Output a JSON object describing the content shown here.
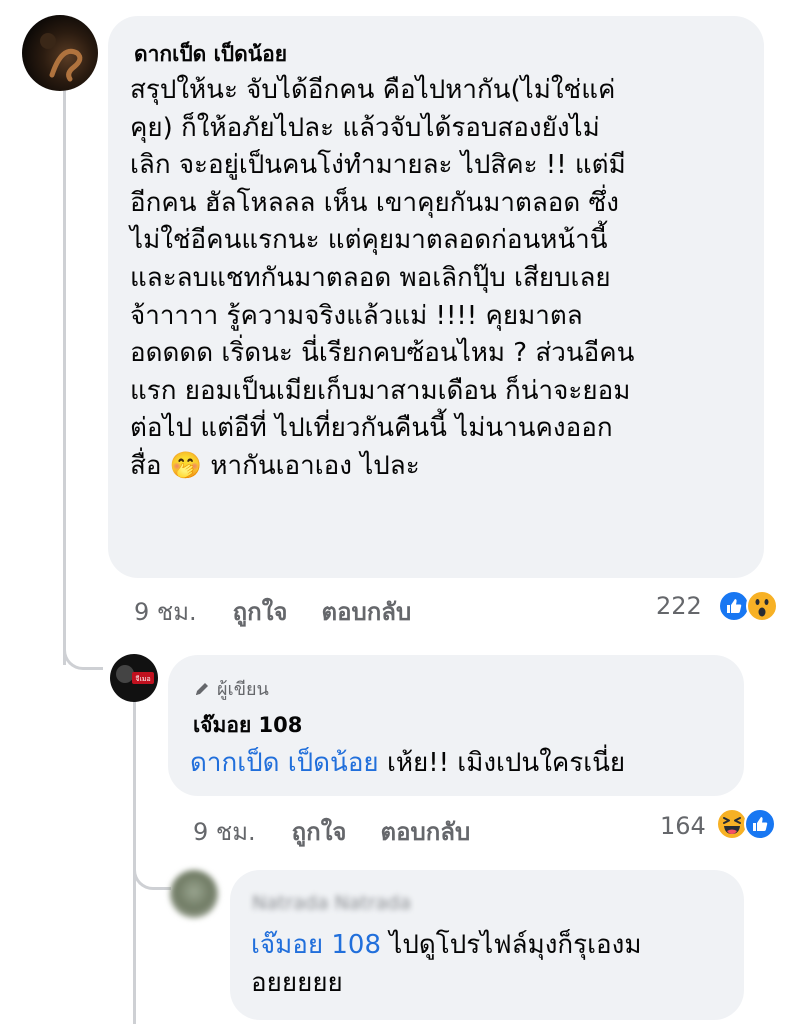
{
  "comment1": {
    "author": "ดากเป็ด เป็ดน้อย",
    "lines": [
      "สรุปให้นะ จับได้อีกคน คือไปหากัน(ไม่ใช่แค่",
      "คุย) ก็ให้อภัยไปละ แล้วจับได้รอบสองยังไม่",
      "เลิก จะอยู่เป็นคนโง่ทำมายละ ไปสิคะ !! แต่มี",
      "อีกคน ฮัลโหลลล เห็น เขาคุยกันมาตลอด ซึ่ง",
      "ไม่ใช่อีคนแรกนะ แต่คุยมาตลอดก่อนหน้านี้",
      "และลบแชทกันมาตลอด พอเลิกปุ๊บ เสียบเลย",
      "จ้าาาาา รู้ความจริงแล้วแม่ !!!! คุยมาตล",
      "อดดดด เริ่ดนะ นี่เรียกคบซ้อนไหม ? ส่วนอีคน",
      "แรก ยอมเป็นเมียเก็บมาสามเดือน ก็น่าจะยอม",
      "ต่อไป แต่อีที่ ไปเที่ยวกันคืนนี้ ไม่นานคงออก"
    ],
    "last_before": "สื่อ",
    "last_emoji": "🤭",
    "last_after": "หากันเอาเอง ไปละ",
    "time": "9 ชม.",
    "like_label": "ถูกใจ",
    "reply_label": "ตอบกลับ",
    "reaction_count": "222",
    "reactions": [
      "like-icon",
      "wow-icon"
    ]
  },
  "comment2": {
    "badge": "ผู้เขียน",
    "author": "เจ๊มอย 108",
    "mention": "ดากเป็ด เป็ดน้อย",
    "text": "เห้ย!! เมิงเปนใครเนี่ย",
    "time": "9 ชม.",
    "like_label": "ถูกใจ",
    "reply_label": "ตอบกลับ",
    "reaction_count": "164",
    "reactions": [
      "haha-icon",
      "like-icon"
    ],
    "avatar_text": "จีเมอ"
  },
  "comment3": {
    "author_blurred": "Natrada Natrada",
    "mention": "เจ๊มอย 108",
    "text_line1": "ไปดูโปรไฟล์มุงก็รุเองม",
    "text_line2": "อยยยยย"
  },
  "colors": {
    "bubble": "#f0f2f5",
    "mention": "#216fdb",
    "meta": "#65676b",
    "like": "#1877f2"
  }
}
